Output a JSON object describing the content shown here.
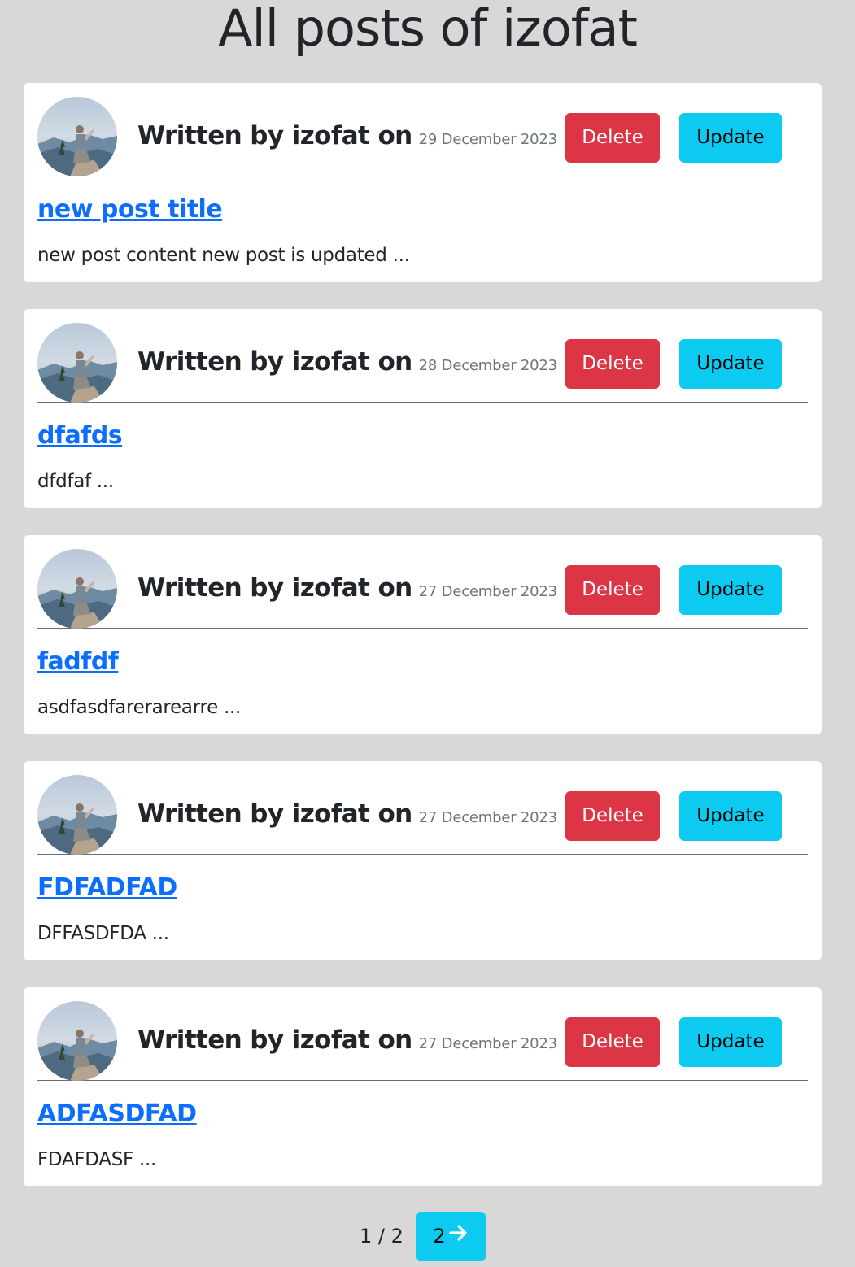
{
  "page": {
    "title": "All posts of izofat"
  },
  "posts": [
    {
      "byline": "Written by izofat on",
      "date": "29 December 2023",
      "delete_label": "Delete",
      "update_label": "Update",
      "title": "new post title",
      "excerpt": "new post content new post is updated ..."
    },
    {
      "byline": "Written by izofat on",
      "date": "28 December 2023",
      "delete_label": "Delete",
      "update_label": "Update",
      "title": "dfafds",
      "excerpt": "dfdfaf ..."
    },
    {
      "byline": "Written by izofat on",
      "date": "27 December 2023",
      "delete_label": "Delete",
      "update_label": "Update",
      "title": "fadfdf",
      "excerpt": "asdfasdfarerarearre ..."
    },
    {
      "byline": "Written by izofat on",
      "date": "27 December 2023",
      "delete_label": "Delete",
      "update_label": "Update",
      "title": "FDFADFAD",
      "excerpt": "DFFASDFDA ..."
    },
    {
      "byline": "Written by izofat on",
      "date": "27 December 2023",
      "delete_label": "Delete",
      "update_label": "Update",
      "title": "ADFASDFAD",
      "excerpt": "FDAFDASF ..."
    }
  ],
  "pagination": {
    "indicator": "1 / 2",
    "next_label": "2",
    "next_icon": "arrow-right-icon"
  },
  "colors": {
    "background": "#d9d7d8",
    "delete": "#dc3545",
    "update": "#0dcaf0",
    "link": "#0d6efd",
    "muted": "#6c757d"
  }
}
